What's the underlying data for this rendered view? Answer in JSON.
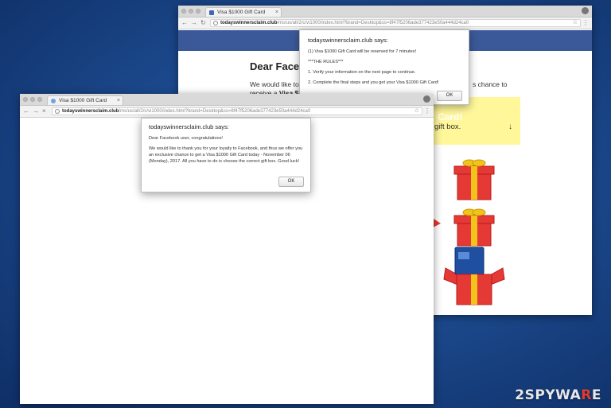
{
  "back_window": {
    "tab_title": "Visa $1000 Gift Card",
    "url_host": "todayswinnersclaim.club",
    "url_path": "/ms/us/all/2/c/vi1000/index.html?brand=Desktop&ss=8f47f5206ade377423e50a444d24ca0",
    "page_heading": "Dear Faceb",
    "page_text_line1": "We would like to th",
    "page_text_line1_right": "s chance to",
    "page_text_line2_prefix": "receive a ",
    "page_text_line2_bold": "Visa $100",
    "yellow_heading": "Card!",
    "yellow_text": "gift box.",
    "yellow_arrow": "↓",
    "dialog": {
      "title": "todayswinnersclaim.club says:",
      "line1": "(1) Visa $1000 Gift Card will be reserved for 7 minutes!",
      "line2": "***THE RULES***",
      "line3": "1. Verify your information on the next page to continue.",
      "line4": "2. Complete the final steps and you get your Visa $1000 Gift Card!",
      "ok_label": "OK"
    }
  },
  "front_window": {
    "tab_title": "Visa $1000 Gift Card",
    "url_host": "todayswinnersclaim.club",
    "url_path": "/ms/us/all/2/c/vi1000/index.html?brand=Desktop&ss=8f47f5206ade377423e50a444d24ca0",
    "dialog": {
      "title": "todayswinnersclaim.club says:",
      "line1": "Dear Facebook user, congratulations!",
      "line2": "We would like to thank you for your loyalty to Facebook, and thus we offer you an exclusive chance to get a Visa $1000 Gift Card today - November 06 (Monday), 2017. All you have to do is choose the correct gift box. Good luck!",
      "ok_label": "OK"
    }
  },
  "watermark": {
    "prefix": "2",
    "brand_a": "SPYWA",
    "brand_r": "R",
    "brand_e": "E"
  },
  "colors": {
    "facebook_blue": "#3b5998",
    "gift_red": "#e53935",
    "ribbon_gold": "#f2c31b",
    "highlight_yellow": "#fff79a"
  }
}
